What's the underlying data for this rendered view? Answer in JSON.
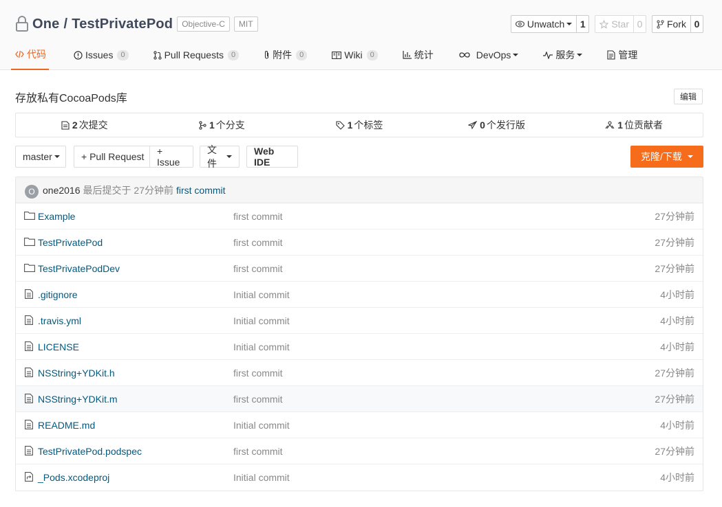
{
  "repo": {
    "owner": "One",
    "separator": "/",
    "name": "TestPrivatePod",
    "tags": [
      "Objective-C",
      "MIT"
    ]
  },
  "actions": {
    "watch": {
      "label": "Unwatch",
      "count": "1"
    },
    "star": {
      "label": "Star",
      "count": "0"
    },
    "fork": {
      "label": "Fork",
      "count": "0"
    }
  },
  "tabs": [
    {
      "label": "代码",
      "icon": "code-icon",
      "active": true
    },
    {
      "label": "Issues",
      "icon": "issue-icon",
      "count": "0"
    },
    {
      "label": "Pull Requests",
      "icon": "pull-request-icon",
      "count": "0"
    },
    {
      "label": "附件",
      "icon": "paperclip-icon",
      "count": "0"
    },
    {
      "label": "Wiki",
      "icon": "book-icon",
      "count": "0"
    },
    {
      "label": "统计",
      "icon": "bar-chart-icon"
    },
    {
      "label": "DevOps",
      "icon": "infinity-icon",
      "dropdown": true
    },
    {
      "label": "服务",
      "icon": "pulse-icon",
      "dropdown": true
    },
    {
      "label": "管理",
      "icon": "settings-doc-icon"
    }
  ],
  "description": "存放私有CocoaPods库",
  "edit_label": "编辑",
  "stats": [
    {
      "icon": "commit-icon",
      "count": "2",
      "label": "次提交"
    },
    {
      "icon": "branch-icon",
      "count": "1",
      "label": "个分支"
    },
    {
      "icon": "tag-icon",
      "count": "1",
      "label": "个标签"
    },
    {
      "icon": "release-icon",
      "count": "0",
      "label": "个发行版"
    },
    {
      "icon": "contributors-icon",
      "count": "1",
      "label": "位贡献者"
    }
  ],
  "toolbar": {
    "branch": "master",
    "pull_request": "+ Pull Request",
    "issue": "+ Issue",
    "files": "文件",
    "web_ide": "Web IDE",
    "clone": "克隆/下载"
  },
  "last_commit": {
    "avatar_letter": "O",
    "author": "one2016",
    "meta": "最后提交于 27分钟前",
    "message": "first commit"
  },
  "files": [
    {
      "name": "Example",
      "type": "folder",
      "message": "first commit",
      "time": "27分钟前"
    },
    {
      "name": "TestPrivatePod",
      "type": "folder",
      "message": "first commit",
      "time": "27分钟前"
    },
    {
      "name": "TestPrivatePodDev",
      "type": "folder",
      "message": "first commit",
      "time": "27分钟前"
    },
    {
      "name": ".gitignore",
      "type": "file",
      "message": "Initial commit",
      "time": "4小时前"
    },
    {
      "name": ".travis.yml",
      "type": "file",
      "message": "Initial commit",
      "time": "4小时前"
    },
    {
      "name": "LICENSE",
      "type": "file",
      "message": "Initial commit",
      "time": "4小时前"
    },
    {
      "name": "NSString+YDKit.h",
      "type": "file",
      "message": "first commit",
      "time": "27分钟前"
    },
    {
      "name": "NSString+YDKit.m",
      "type": "file",
      "message": "first commit",
      "time": "27分钟前"
    },
    {
      "name": "README.md",
      "type": "file",
      "message": "Initial commit",
      "time": "4小时前"
    },
    {
      "name": "TestPrivatePod.podspec",
      "type": "file",
      "message": "first commit",
      "time": "27分钟前"
    },
    {
      "name": "_Pods.xcodeproj",
      "type": "symlink",
      "message": "Initial commit",
      "time": "4小时前"
    }
  ],
  "colors": {
    "accent": "#f16520",
    "clone_button": "#f76c1b",
    "link": "#005980"
  }
}
